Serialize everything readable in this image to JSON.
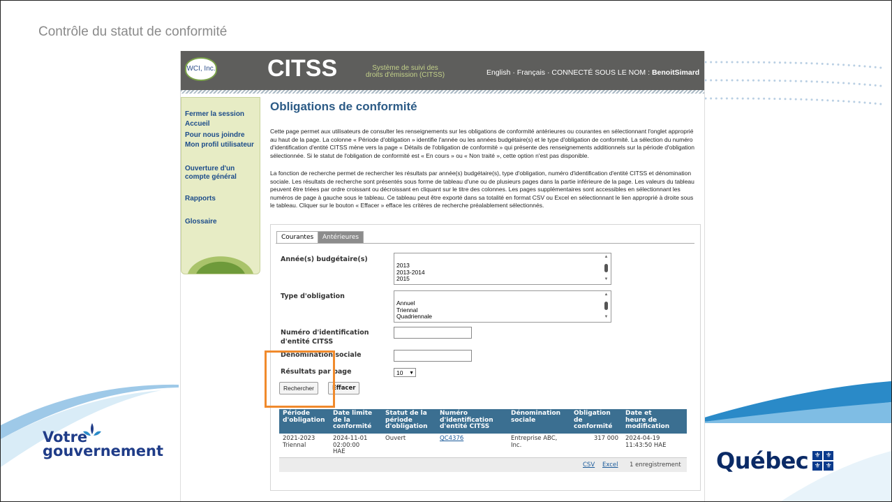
{
  "slide": {
    "title": "Contrôle du statut de conformité",
    "gov_logo_line1": "Votre",
    "gov_logo_line2": "gouvernement",
    "quebec_logo": "Québec",
    "accent_blue": "#2a8ac8"
  },
  "header": {
    "wci_logo": "WCI, Inc.",
    "app_name": "CITSS",
    "subtitle_line1": "Système de suivi des",
    "subtitle_line2": "droits d'émission (CITSS)",
    "lang_en": "English",
    "lang_fr": "Français",
    "logged_label": "CONNECTÉ SOUS LE NOM :",
    "username": "BenoitSimard"
  },
  "sidebar": {
    "items": [
      {
        "label": "Fermer la session"
      },
      {
        "label": "Accueil"
      },
      {
        "label": "Pour nous joindre"
      },
      {
        "label": "Mon profil utilisateur"
      },
      {
        "label": "Ouverture d'un compte général"
      },
      {
        "label": "Rapports"
      },
      {
        "label": "Glossaire"
      }
    ]
  },
  "main": {
    "title": "Obligations de conformité",
    "para1": "Cette page permet aux utilisateurs de consulter les renseignements sur les obligations de conformité antérieures ou courantes en sélectionnant l'onglet approprié au haut de la page. La colonne « Période d'obligation » identifie l'année ou les années budgétaire(s) et le type d'obligation de conformité. La sélection du numéro d'identification d'entité CITSS mène vers la page « Détails de l'obligation de conformité » qui présente des renseignements additionnels sur la période d'obligation sélectionnée. Si le statut de l'obligation de conformité est « En cours » ou « Non traité », cette option n'est pas disponible.",
    "para2": "La fonction de recherche permet de rechercher les résultats par année(s) budgétaire(s), type d'obligation, numéro d'identification d'entité CITSS et dénomination sociale. Les résultats de recherche sont présentés sous forme de tableau d'une ou de plusieurs pages dans la partie inférieure de la page. Les valeurs du tableau peuvent être triées par ordre croissant ou décroissant en cliquant sur le titre des colonnes. Les pages supplémentaires sont accessibles en sélectionnant les numéros de page à gauche sous le tableau. Ce tableau peut être exporté dans sa totalité en format CSV ou Excel en sélectionnant le lien approprié à droite sous le tableau. Cliquer sur le bouton « Effacer » efface les critères de recherche préalablement sélectionnés.",
    "tabs": [
      {
        "label": "Courantes"
      },
      {
        "label": "Antérieures"
      }
    ],
    "form": {
      "years_label": "Année(s) budgétaire(s)",
      "years_options": [
        "2013",
        "2013-2014",
        "2015"
      ],
      "type_label": "Type d'obligation",
      "type_options": [
        "Annuel",
        "Triennal",
        "Quadriennale"
      ],
      "entity_label_1": "Numéro d'identification",
      "entity_label_2": "d'entité CITSS",
      "entity_value": "",
      "name_label": "Dénomination sociale",
      "name_value": "",
      "per_page_label": "Résultats par page",
      "per_page_value": "10",
      "search_button": "Rechercher",
      "clear_button": "Effacer"
    },
    "table": {
      "headers": [
        [
          "Période",
          "d'obligation",
          ""
        ],
        [
          "Date limite",
          "de la",
          "conformité"
        ],
        [
          "Statut de la",
          "période",
          "d'obligation"
        ],
        [
          "Numéro",
          "d'identification",
          "d'entité CITSS"
        ],
        [
          "Dénomination",
          "sociale",
          ""
        ],
        [
          "Obligation",
          "de",
          "conformité"
        ],
        [
          "Date et",
          "heure de",
          "modification"
        ]
      ],
      "row": {
        "period_1": "2021-2023",
        "period_2": "Triennal",
        "deadline_1": "2024-11-01",
        "deadline_2": "02:00:00",
        "deadline_3": "HAE",
        "status": "Ouvert",
        "entity_id": "QC4376",
        "name_1": "Entreprise ABC,",
        "name_2": "Inc.",
        "obligation": "317 000",
        "modified_1": "2024-04-19",
        "modified_2": "11:43:50 HAE"
      },
      "footer": {
        "csv": "CSV",
        "excel": "Excel",
        "count": "1 enregistrement"
      }
    }
  },
  "highlight_color": "#f08a2c"
}
